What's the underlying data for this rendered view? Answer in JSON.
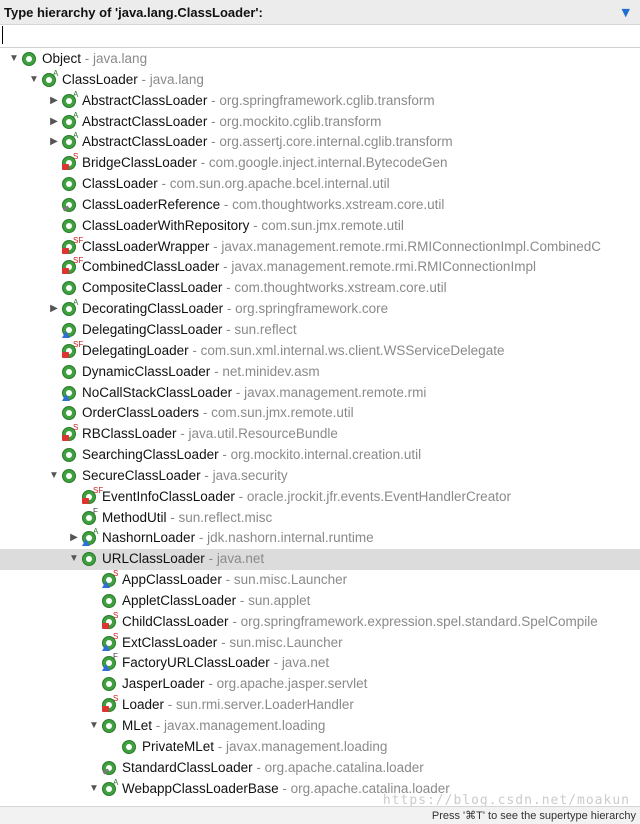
{
  "header": {
    "title": "Type hierarchy of 'java.lang.ClassLoader':",
    "menu_icon": "chevron-down-icon"
  },
  "search": {
    "value": "",
    "placeholder": ""
  },
  "tree": {
    "rows": [
      {
        "name": "Object",
        "pkg": "java.lang",
        "depth": 0,
        "arrow": "expanded",
        "overlay": "",
        "badge": ""
      },
      {
        "name": "ClassLoader",
        "pkg": "java.lang",
        "depth": 1,
        "arrow": "expanded",
        "overlay": "A",
        "badge": ""
      },
      {
        "name": "AbstractClassLoader",
        "pkg": "org.springframework.cglib.transform",
        "depth": 2,
        "arrow": "collapsed",
        "overlay": "A",
        "badge": ""
      },
      {
        "name": "AbstractClassLoader",
        "pkg": "org.mockito.cglib.transform",
        "depth": 2,
        "arrow": "collapsed",
        "overlay": "A",
        "badge": ""
      },
      {
        "name": "AbstractClassLoader",
        "pkg": "org.assertj.core.internal.cglib.transform",
        "depth": 2,
        "arrow": "collapsed",
        "overlay": "A",
        "badge": ""
      },
      {
        "name": "BridgeClassLoader",
        "pkg": "com.google.inject.internal.BytecodeGen",
        "depth": 2,
        "arrow": "",
        "overlay": "S",
        "badge": "lock"
      },
      {
        "name": "ClassLoader",
        "pkg": "com.sun.org.apache.bcel.internal.util",
        "depth": 2,
        "arrow": "",
        "overlay": "",
        "badge": ""
      },
      {
        "name": "ClassLoaderReference",
        "pkg": "com.thoughtworks.xstream.core.util",
        "depth": 2,
        "arrow": "",
        "overlay": "",
        "badge": "key"
      },
      {
        "name": "ClassLoaderWithRepository",
        "pkg": "com.sun.jmx.remote.util",
        "depth": 2,
        "arrow": "",
        "overlay": "",
        "badge": ""
      },
      {
        "name": "ClassLoaderWrapper",
        "pkg": "javax.management.remote.rmi.RMIConnectionImpl.CombinedC",
        "depth": 2,
        "arrow": "",
        "overlay": "SF",
        "badge": "lock"
      },
      {
        "name": "CombinedClassLoader",
        "pkg": "javax.management.remote.rmi.RMIConnectionImpl",
        "depth": 2,
        "arrow": "",
        "overlay": "SF",
        "badge": "lock"
      },
      {
        "name": "CompositeClassLoader",
        "pkg": "com.thoughtworks.xstream.core.util",
        "depth": 2,
        "arrow": "",
        "overlay": "",
        "badge": ""
      },
      {
        "name": "DecoratingClassLoader",
        "pkg": "org.springframework.core",
        "depth": 2,
        "arrow": "collapsed",
        "overlay": "A",
        "badge": ""
      },
      {
        "name": "DelegatingClassLoader",
        "pkg": "sun.reflect",
        "depth": 2,
        "arrow": "",
        "overlay": "",
        "badge": "tri"
      },
      {
        "name": "DelegatingLoader",
        "pkg": "com.sun.xml.internal.ws.client.WSServiceDelegate",
        "depth": 2,
        "arrow": "",
        "overlay": "SF",
        "badge": "lock"
      },
      {
        "name": "DynamicClassLoader",
        "pkg": "net.minidev.asm",
        "depth": 2,
        "arrow": "",
        "overlay": "",
        "badge": ""
      },
      {
        "name": "NoCallStackClassLoader",
        "pkg": "javax.management.remote.rmi",
        "depth": 2,
        "arrow": "",
        "overlay": "",
        "badge": "tri"
      },
      {
        "name": "OrderClassLoaders",
        "pkg": "com.sun.jmx.remote.util",
        "depth": 2,
        "arrow": "",
        "overlay": "",
        "badge": ""
      },
      {
        "name": "RBClassLoader",
        "pkg": "java.util.ResourceBundle",
        "depth": 2,
        "arrow": "",
        "overlay": "S",
        "badge": "lock"
      },
      {
        "name": "SearchingClassLoader",
        "pkg": "org.mockito.internal.creation.util",
        "depth": 2,
        "arrow": "",
        "overlay": "",
        "badge": ""
      },
      {
        "name": "SecureClassLoader",
        "pkg": "java.security",
        "depth": 2,
        "arrow": "expanded",
        "overlay": "",
        "badge": ""
      },
      {
        "name": "EventInfoClassLoader",
        "pkg": "oracle.jrockit.jfr.events.EventHandlerCreator",
        "depth": 3,
        "arrow": "",
        "overlay": "SF",
        "badge": "lock"
      },
      {
        "name": "MethodUtil",
        "pkg": "sun.reflect.misc",
        "depth": 3,
        "arrow": "",
        "overlay": "F",
        "badge": ""
      },
      {
        "name": "NashornLoader",
        "pkg": "jdk.nashorn.internal.runtime",
        "depth": 3,
        "arrow": "collapsed",
        "overlay": "A",
        "badge": "tri"
      },
      {
        "name": "URLClassLoader",
        "pkg": "java.net",
        "depth": 3,
        "arrow": "expanded",
        "overlay": "",
        "badge": "",
        "selected": true
      },
      {
        "name": "AppClassLoader",
        "pkg": "sun.misc.Launcher",
        "depth": 4,
        "arrow": "",
        "overlay": "S",
        "badge": "tri"
      },
      {
        "name": "AppletClassLoader",
        "pkg": "sun.applet",
        "depth": 4,
        "arrow": "",
        "overlay": "",
        "badge": ""
      },
      {
        "name": "ChildClassLoader",
        "pkg": "org.springframework.expression.spel.standard.SpelCompile",
        "depth": 4,
        "arrow": "",
        "overlay": "S",
        "badge": "lock"
      },
      {
        "name": "ExtClassLoader",
        "pkg": "sun.misc.Launcher",
        "depth": 4,
        "arrow": "",
        "overlay": "S",
        "badge": "tri"
      },
      {
        "name": "FactoryURLClassLoader",
        "pkg": "java.net",
        "depth": 4,
        "arrow": "",
        "overlay": "F",
        "badge": "tri"
      },
      {
        "name": "JasperLoader",
        "pkg": "org.apache.jasper.servlet",
        "depth": 4,
        "arrow": "",
        "overlay": "",
        "badge": ""
      },
      {
        "name": "Loader",
        "pkg": "sun.rmi.server.LoaderHandler",
        "depth": 4,
        "arrow": "",
        "overlay": "S",
        "badge": "lock"
      },
      {
        "name": "MLet",
        "pkg": "javax.management.loading",
        "depth": 4,
        "arrow": "expanded",
        "overlay": "",
        "badge": ""
      },
      {
        "name": "PrivateMLet",
        "pkg": "javax.management.loading",
        "depth": 5,
        "arrow": "",
        "overlay": "",
        "badge": ""
      },
      {
        "name": "StandardClassLoader",
        "pkg": "org.apache.catalina.loader",
        "depth": 4,
        "arrow": "",
        "overlay": "",
        "badge": "key"
      },
      {
        "name": "WebappClassLoaderBase",
        "pkg": "org.apache.catalina.loader",
        "depth": 4,
        "arrow": "expanded",
        "overlay": "A",
        "badge": ""
      }
    ]
  },
  "footer": {
    "hint": "Press '⌘T' to see the supertype hierarchy"
  },
  "watermark": "https://blog.csdn.net/moakun",
  "colors": {
    "class_icon": "#3fa03f",
    "package_text": "#8a8a8a",
    "selected_row": "#dcdcdc",
    "accent": "#1f6fd0"
  }
}
